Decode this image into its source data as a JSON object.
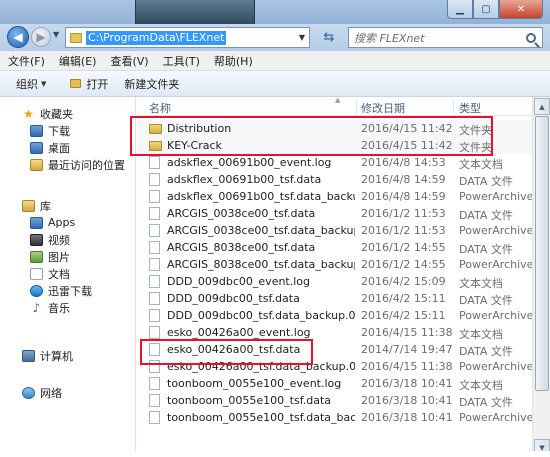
{
  "address": {
    "path": "C:\\ProgramData\\FLEXnet",
    "search_placeholder": "搜索 FLEXnet"
  },
  "menu": [
    "文件(F)",
    "编辑(E)",
    "查看(V)",
    "工具(T)",
    "帮助(H)"
  ],
  "toolbar": {
    "organize": "组织",
    "open": "打开",
    "new_folder": "新建文件夹"
  },
  "nav": {
    "favorites": "收藏夹",
    "favorites_items": [
      "下载",
      "桌面",
      "最近访问的位置"
    ],
    "libraries": "库",
    "library_items": [
      "Apps",
      "视频",
      "图片",
      "文档",
      "迅雷下载",
      "音乐"
    ],
    "computer": "计算机",
    "network": "网络"
  },
  "columns": {
    "name": "名称",
    "date": "修改日期",
    "type": "类型"
  },
  "files": [
    {
      "name": "Distribution",
      "date": "2016/4/15 11:42",
      "type": "文件夹",
      "folder": true
    },
    {
      "name": "KEY-Crack",
      "date": "2016/4/15 11:42",
      "type": "文件夹",
      "folder": true
    },
    {
      "name": "adskflex_00691b00_event.log",
      "date": "2016/4/8 14:53",
      "type": "文本文档"
    },
    {
      "name": "adskflex_00691b00_tsf.data",
      "date": "2016/4/8 14:59",
      "type": "DATA 文件"
    },
    {
      "name": "adskflex_00691b00_tsf.data_backup.0...",
      "date": "2016/4/8 14:59",
      "type": "PowerArchiver"
    },
    {
      "name": "ARCGIS_0038ce00_tsf.data",
      "date": "2016/1/2 11:53",
      "type": "DATA 文件"
    },
    {
      "name": "ARCGIS_0038ce00_tsf.data_backup.001",
      "date": "2016/1/2 11:53",
      "type": "PowerArchiver"
    },
    {
      "name": "ARCGIS_8038ce00_tsf.data",
      "date": "2016/1/2 14:55",
      "type": "DATA 文件"
    },
    {
      "name": "ARCGIS_8038ce00_tsf.data_backup.001",
      "date": "2016/1/2 14:55",
      "type": "PowerArchiver"
    },
    {
      "name": "DDD_009dbc00_event.log",
      "date": "2016/4/2 15:09",
      "type": "文本文档"
    },
    {
      "name": "DDD_009dbc00_tsf.data",
      "date": "2016/4/2 15:11",
      "type": "DATA 文件"
    },
    {
      "name": "DDD_009dbc00_tsf.data_backup.001",
      "date": "2016/4/2 15:11",
      "type": "PowerArchiver"
    },
    {
      "name": "esko_00426a00_event.log",
      "date": "2016/4/15 11:38",
      "type": "文本文档"
    },
    {
      "name": "esko_00426a00_tsf.data",
      "date": "2014/7/14 19:47",
      "type": "DATA 文件"
    },
    {
      "name": "esko_00426a00_tsf.data_backup.001",
      "date": "2016/4/15 11:38",
      "type": "PowerArchiver"
    },
    {
      "name": "toonboom_0055e100_event.log",
      "date": "2016/3/18 10:41",
      "type": "文本文档"
    },
    {
      "name": "toonboom_0055e100_tsf.data",
      "date": "2016/3/18 10:41",
      "type": "DATA 文件"
    },
    {
      "name": "toonboom_0055e100_tsf.data_backu...",
      "date": "2016/3/18 10:41",
      "type": "PowerArchiver"
    }
  ],
  "colors": {
    "highlight": "#e8112d",
    "selection": "#3399ff"
  }
}
